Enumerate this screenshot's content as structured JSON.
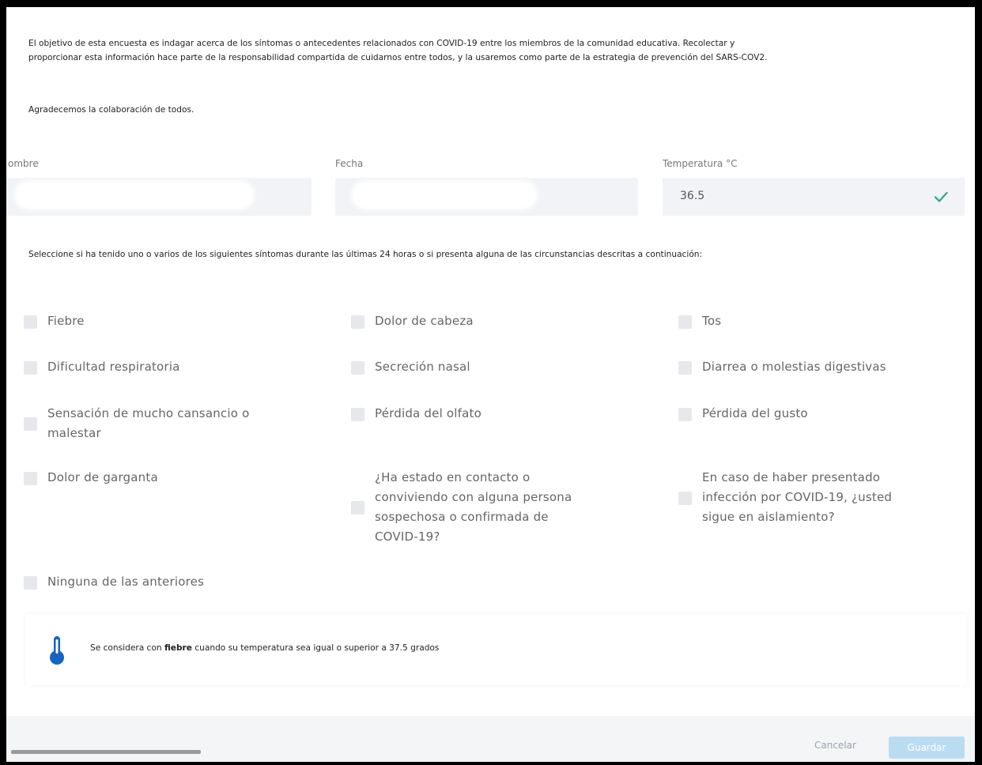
{
  "intro": {
    "line1": "El objetivo de esta encuesta es indagar acerca de los síntomas o antecedentes relacionados con COVID-19 entre los miembros de la comunidad educativa. Recolectar y",
    "line2": "proporcionar esta información hace parte de la responsabilidad compartida de cuidarnos entre todos, y la usaremos como parte de la estrategia de prevención del SARS-COV2.",
    "thanks": "Agradecemos la colaboración de todos."
  },
  "fields": {
    "nombre_label": "ombre",
    "fecha_label": "Fecha",
    "temperatura_label": "Temperatura °C",
    "temperatura_value": "36.5"
  },
  "instructions": "Seleccione si ha tenido uno o varios de los siguientes síntomas durante las últimas 24 horas o si presenta alguna de las circunstancias descritas a continuación:",
  "options": [
    {
      "label": "Fiebre",
      "checked": false
    },
    {
      "label": "Dolor de cabeza",
      "checked": false
    },
    {
      "label": "Tos",
      "checked": false
    },
    {
      "label": "Dificultad respiratoria",
      "checked": false
    },
    {
      "label": "Secreción nasal",
      "checked": false
    },
    {
      "label": "Diarrea o molestias digestivas",
      "checked": false
    },
    {
      "label": "Sensación de mucho cansancio o\nmalestar",
      "checked": false
    },
    {
      "label": "Pérdida del olfato",
      "checked": false
    },
    {
      "label": "Pérdida del gusto",
      "checked": false
    },
    {
      "label": "Dolor de garganta",
      "checked": false
    },
    {
      "label": "¿Ha estado en contacto o\nconviviendo con alguna persona\nsospechosa o confirmada de\nCOVID-19?",
      "checked": false
    },
    {
      "label": "En caso de haber presentado\ninfección por COVID-19, ¿usted\nsigue en aislamiento?",
      "checked": false
    },
    {
      "label": "Ninguna de las anteriores",
      "checked": false
    }
  ],
  "note": {
    "prefix": "Se considera con ",
    "bold": "fiebre",
    "suffix": " cuando su temperatura sea igual o superior a 37.5 grados",
    "icon": "thermometer-icon"
  },
  "footer": {
    "cancel_label": "Cancelar",
    "save_label": "Guardar"
  },
  "colors": {
    "check": "#3aa98f",
    "thermometer": "#1565c0",
    "save_button": "#b9dcf2"
  }
}
